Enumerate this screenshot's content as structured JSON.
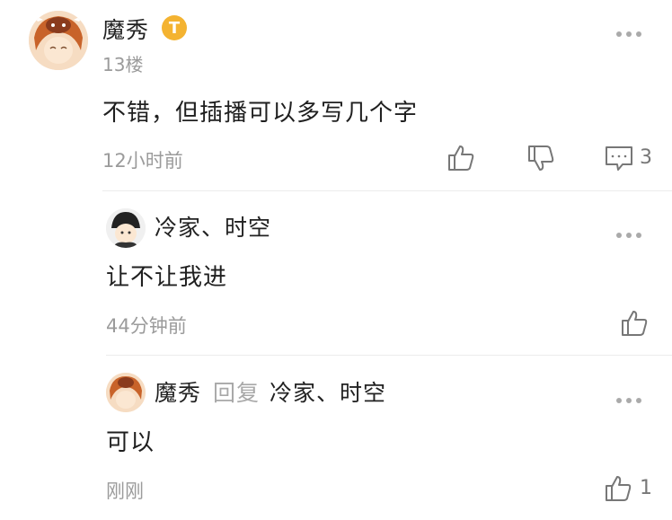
{
  "comment": {
    "author": "魔秀",
    "badge": "T",
    "floor": "13楼",
    "text": "不错，但插播可以多写几个字",
    "time": "12小时前",
    "reply_count": "3",
    "icons": [
      "avatar",
      "vip-badge-icon",
      "more-icon",
      "thumbs-up-icon",
      "thumbs-down-icon",
      "comment-icon"
    ]
  },
  "replies": [
    {
      "author": "冷家、时空",
      "text": "让不让我进",
      "time": "44分钟前",
      "like_count": ""
    },
    {
      "author": "魔秀",
      "reply_word": "回复",
      "reply_to": "冷家、时空",
      "text": "可以",
      "time": "刚刚",
      "like_count": "1"
    }
  ],
  "colors": {
    "badge": "#f4b331",
    "muted_text": "#9b9b9b",
    "primary_text": "#1f1f1f"
  }
}
